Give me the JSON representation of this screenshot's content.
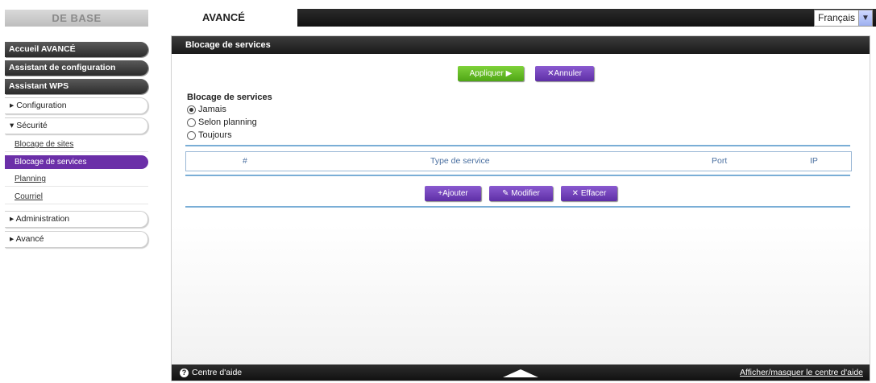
{
  "top_tabs": {
    "basic": "DE BASE",
    "advanced": "AVANCÉ"
  },
  "language": {
    "selected": "Français",
    "dropdown_icon": "chevron-down-icon"
  },
  "sidebar": {
    "main_items": [
      {
        "label": "Accueil AVANCÉ"
      },
      {
        "label": "Assistant de configuration"
      },
      {
        "label": "Assistant WPS"
      }
    ],
    "sections": [
      {
        "label": "▸ Configuration"
      },
      {
        "label": "▾ Sécurité"
      }
    ],
    "security_subitems": [
      {
        "label": "Blocage de sites"
      },
      {
        "label": "Blocage de services"
      },
      {
        "label": "Planning"
      },
      {
        "label": "Courriel"
      }
    ],
    "bottom_sections": [
      {
        "label": "▸ Administration"
      },
      {
        "label": "▸ Avancé"
      }
    ],
    "active_item": "Blocage de services"
  },
  "panel": {
    "title": "Blocage de services",
    "apply_label": "Appliquer ▶",
    "cancel_label": "✕Annuler",
    "section_title": "Blocage de services",
    "radio_options": [
      {
        "label": "Jamais",
        "checked": true
      },
      {
        "label": "Selon planning",
        "checked": false
      },
      {
        "label": "Toujours",
        "checked": false
      }
    ],
    "table": {
      "headers": [
        "#",
        "Type de service",
        "Port",
        "IP"
      ]
    },
    "add_label": "+Ajouter",
    "edit_label": "Modifier",
    "clear_label": "Effacer"
  },
  "footer": {
    "help_label": "Centre d'aide",
    "toggle_label": "Afficher/masquer le centre d'aide"
  },
  "colors": {
    "accent_purple": "#6b2fa8",
    "apply_green": "#5cb31f",
    "divider_blue": "#7aaed6"
  }
}
